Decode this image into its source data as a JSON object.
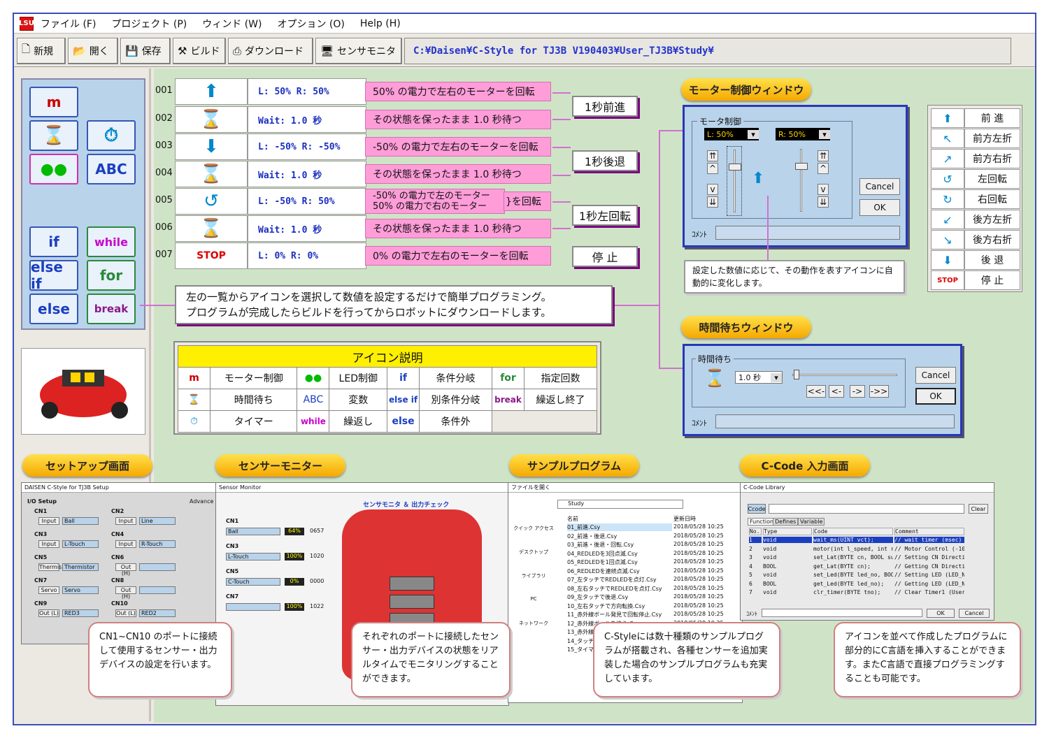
{
  "menu": {
    "app_icon": "LSU",
    "items": [
      "ファイル (F)",
      "プロジェクト (P)",
      "ウィンド (W)",
      "オプション (O)",
      "Help (H)"
    ]
  },
  "toolbar": {
    "new": "新規",
    "open": "開く",
    "save": "保存",
    "build": "ビルド",
    "download": "ダウンロード",
    "sensor": "センサモニタ",
    "path": "C:¥Daisen¥C-Style for TJ3B V190403¥User_TJ3B¥Study¥"
  },
  "palette": {
    "m": "m",
    "abc": "ABC",
    "if": "if",
    "while": "while",
    "elseif": "else if",
    "for": "for",
    "else": "else",
    "break": "break"
  },
  "program": [
    {
      "num": "001",
      "value": "L:  50%  R:  50%",
      "desc": "50% の電力で左右のモーターを回転"
    },
    {
      "num": "002",
      "value": "Wait: 1.0 秒",
      "desc": "その状態を保ったまま 1.0 秒待つ"
    },
    {
      "num": "003",
      "value": "L: -50%  R: -50%",
      "desc": "-50% の電力で左右のモーターを回転"
    },
    {
      "num": "004",
      "value": "Wait: 1.0 秒",
      "desc": "その状態を保ったまま 1.0 秒待つ"
    },
    {
      "num": "005",
      "value": "L: -50%  R:  50%",
      "desc": "-50% の電力で左のモーター\n50% の電力で右のモーター",
      "desc2": "}を回転"
    },
    {
      "num": "006",
      "value": "Wait: 1.0 秒",
      "desc": "その状態を保ったまま 1.0 秒待つ"
    },
    {
      "num": "007",
      "value": "L:   0%  R:   0%",
      "desc": "0% の電力で左右のモーターを回転"
    }
  ],
  "tags": [
    "1秒前進",
    "1秒後退",
    "1秒左回転",
    "停 止"
  ],
  "main_callout": {
    "line1": "左の一覧からアイコンを選択して数値を設定するだけで簡単プログラミング。",
    "line2": "プログラムが完成したらビルドを行ってからロボットにダウンロードします。"
  },
  "legend": {
    "title": "アイコン説明",
    "rows": [
      [
        "モーター制御",
        "LED制御",
        "条件分岐",
        "指定回数"
      ],
      [
        "時間待ち",
        "変数",
        "別条件分岐",
        "繰返し終了"
      ],
      [
        "タイマー",
        "繰返し",
        "条件外",
        ""
      ]
    ],
    "icons": [
      "m",
      "ABC",
      "if",
      "for",
      "else if",
      "break",
      "while",
      "else"
    ]
  },
  "motor": {
    "pill": "モーター制御ウィンドウ",
    "group": "モータ制御",
    "l": "L: 50%",
    "r": "R: 50%",
    "cancel": "Cancel",
    "ok": "OK",
    "comment": "ｺﾒﾝﾄ",
    "note": "設定した数値に応じて、その動作を表すアイコンに自動的に変化します。"
  },
  "wait": {
    "pill": "時間待ちウィンドウ",
    "group": "時間待ち",
    "value": "1.0 秒",
    "cancel": "Cancel",
    "ok": "OK",
    "comment": "ｺﾒﾝﾄ",
    "b1": "<<-",
    "b2": "<-",
    "b3": "->",
    "b4": "->>"
  },
  "commands": [
    "前 進",
    "前方左折",
    "前方右折",
    "左回転",
    "右回転",
    "後方左折",
    "後方右折",
    "後 退",
    "停 止"
  ],
  "bottom": {
    "pills": [
      "セットアップ画面",
      "センサーモニター",
      "サンプルプログラム",
      "C-Code 入力画面"
    ],
    "callouts": [
      "CN1~CN10 のポートに接続して使用するセンサー・出力デバイスの設定を行います。",
      "それぞれのポートに接続したセンサー・出力デバイスの状態をリアルタイムでモニタリングすることができます。",
      "C-Styleには数十種類のサンプルプログラムが搭載され、各種センサーを追加実装した場合のサンプルプログラムも充実しています。",
      "アイコンを並べて作成したプログラムに部分的にC言語を挿入することができます。またC言語で直接プログラミングすることも可能です。"
    ],
    "setup_title": "DAISEN C-Style for TJ3B Setup",
    "setup_io": "I/O Setup",
    "setup_adv": "Advance",
    "setup_rows": [
      [
        "CN1",
        "Input",
        "Ball",
        "CN2",
        "Input",
        "Line"
      ],
      [
        "CN3",
        "Input",
        "L-Touch",
        "CN4",
        "Input",
        "R-Touch"
      ],
      [
        "CN5",
        "Thermis",
        "Thermistor",
        "CN6",
        "Out (H)",
        ""
      ],
      [
        "CN7",
        "Servo",
        "Servo",
        "CN8",
        "Out (H)",
        ""
      ],
      [
        "CN9",
        "Out (L)",
        "RED3",
        "CN10",
        "Out (L)",
        "RED2"
      ]
    ],
    "sensor_title": "Sensor Monitor",
    "sensor_head": "センサモニタ ＆ 出力チェック",
    "sensor_rows": [
      [
        "CN1",
        "Ball",
        "64%",
        "0657"
      ],
      [
        "CN3",
        "L-Touch",
        "100%",
        "1020"
      ],
      [
        "CN5",
        "C-Touch",
        "0%",
        "0000"
      ],
      [
        "CN7",
        "",
        "100%",
        "1022"
      ]
    ],
    "sample_title": "ファイルを開く",
    "sample_folder": "Study",
    "sample_col_name": "名前",
    "sample_col_date": "更新日時",
    "sample_files": [
      "01_前進.Csy",
      "02_前進・後退.Csy",
      "03_前進・後退・回転.Csy",
      "04_REDLEDを3回点滅.Csy",
      "05_REDLEDを1回点滅.Csy",
      "06_REDLEDを連続点滅.Csy",
      "07_左タッチでREDLEDを点灯.Csy",
      "08_左右タッチでREDLEDを点灯.Csy",
      "09_左タッチで後退.Csy",
      "10_左右タッチで方向転換.Csy",
      "11_赤外線ボール発見で回転停止.Csy",
      "12_赤外線ボールを追う.Csy",
      "13_赤外線ボールを追う2.Csy",
      "14_タッチで.Csy",
      "15_タイマー.Csy"
    ],
    "sample_date": "2018/05/28 10:25",
    "sample_side": [
      "クイック アクセス",
      "デスクトップ",
      "ライブラリ",
      "PC",
      "ネットワーク"
    ],
    "ccode_title": "C-Code Library",
    "ccode_btn": "Ccode",
    "ccode_clear": "Clear",
    "ccode_tabs": [
      "Function",
      "Defines",
      "Variable"
    ],
    "ccode_head": [
      "No.",
      "Type",
      "Code",
      "Comment"
    ],
    "ccode_rows": [
      [
        "1",
        "void",
        "wait_ms(UINT vct);",
        "// wait timer (msec)"
      ],
      [
        "2",
        "void",
        "motor(int l_speed, int r",
        "// Motor Control (-100~"
      ],
      [
        "3",
        "void",
        "set_Lat(BYTE cn, BOOL su",
        "// Setting CN Direction"
      ],
      [
        "4",
        "BOOL",
        "get_Lat(BYTE cn);",
        "// Getting CN Direction"
      ],
      [
        "5",
        "void",
        "set_Led(BYTE led_no, BOO",
        "// Setting LED (LED_No."
      ],
      [
        "6",
        "BOOL",
        "get_Led(BYTE led_no);",
        "// Getting LED (LED_No)"
      ],
      [
        "7",
        "void",
        "clr_timer(BYTE tno);",
        "// Clear Timer1 (UserTim"
      ]
    ],
    "ccode_ok": "OK",
    "ccode_cancel": "Cancel",
    "ccode_comment": "ｺﾒﾝﾄ"
  }
}
